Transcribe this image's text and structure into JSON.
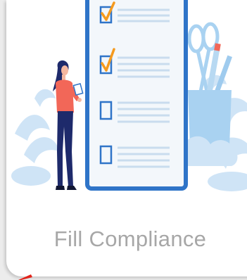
{
  "card": {
    "title": "Fill Compliance",
    "illustration_icon": "checklist-illustration-icon",
    "checklist": [
      {
        "checked": true
      },
      {
        "checked": true
      },
      {
        "checked": false
      },
      {
        "checked": false
      }
    ]
  },
  "colors": {
    "title": "#a7a7a7",
    "clipboard_border": "#2f74c8",
    "clipboard_fill": "#f3f7fb",
    "checkmark": "#f59a1e",
    "checkbox": "#2f74c8",
    "line": "#c9dcee",
    "foliage": "#bfdcf3",
    "cup": "#a9d2f1",
    "person_shirt": "#f26758",
    "person_pants": "#1e2a6b",
    "person_hair": "#1e2a6b",
    "accent": "#e2231a"
  }
}
